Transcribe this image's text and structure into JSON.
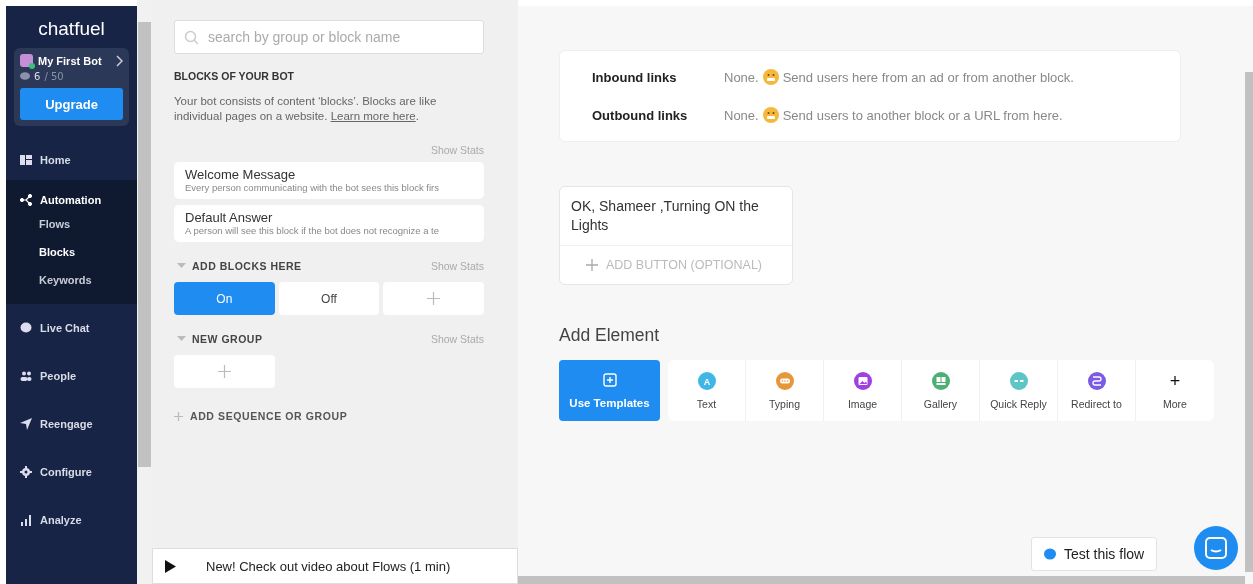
{
  "sidebar": {
    "logo": "chatfuel",
    "bot": {
      "name": "My First Bot",
      "used": "6",
      "limit": "/ 50",
      "upgrade": "Upgrade"
    },
    "items": [
      {
        "label": "Home",
        "kind": "home",
        "selected": false
      },
      {
        "label": "Automation",
        "kind": "automation",
        "selected": true,
        "expanded": true,
        "children": [
          {
            "label": "Flows",
            "selected": false
          },
          {
            "label": "Blocks",
            "selected": true
          },
          {
            "label": "Keywords",
            "selected": false
          }
        ]
      },
      {
        "label": "Live Chat",
        "kind": "chat",
        "selected": false
      },
      {
        "label": "People",
        "kind": "people",
        "selected": false
      },
      {
        "label": "Reengage",
        "kind": "send",
        "selected": false
      },
      {
        "label": "Configure",
        "kind": "gear",
        "selected": false
      },
      {
        "label": "Analyze",
        "kind": "bars",
        "selected": false
      }
    ]
  },
  "blocks_panel": {
    "search": {
      "placeholder": "search by group or block name"
    },
    "heading": "BLOCKS OF YOUR BOT",
    "intro": "Your bot consists of content ‘blocks’. Blocks are like individual pages on a website.",
    "intro_link": "Learn more here",
    "intro_end": ".",
    "show_stats": "Show Stats",
    "blocks": [
      {
        "title": "Welcome Message",
        "subtitle": "Every person communicating with the bot sees this block firs"
      },
      {
        "title": "Default Answer",
        "subtitle": "A person will see this block if the bot does not recognize a te"
      }
    ],
    "groups": [
      {
        "name": "ADD BLOCKS HERE",
        "show_stats": "Show Stats",
        "expanded": true,
        "blocks": [
          {
            "label": "On",
            "selected": true
          },
          {
            "label": "Off",
            "selected": false
          }
        ]
      },
      {
        "name": "NEW GROUP",
        "show_stats": "Show Stats",
        "expanded": true
      }
    ],
    "add_group": "ADD SEQUENCE OR GROUP",
    "video_banner": "New! Check out video about Flows (1 min)"
  },
  "editor": {
    "links": [
      {
        "label": "Inbound links",
        "none": "None.",
        "text": "Send users here from an ad or from another block."
      },
      {
        "label": "Outbound links",
        "none": "None.",
        "text": "Send users to another block or a URL from here."
      }
    ],
    "message": "OK, Shameer ,Turning ON the Lights",
    "add_button": "ADD BUTTON (OPTIONAL)",
    "add_element_title": "Add Element",
    "templates": "Use Templates",
    "elements": [
      {
        "label": "Text",
        "kind": "letter",
        "glyph": "A",
        "color": "#3fb6e6"
      },
      {
        "label": "Typing",
        "kind": "dots",
        "color": "#e8963a"
      },
      {
        "label": "Image",
        "kind": "image",
        "color": "#a23fe0"
      },
      {
        "label": "Gallery",
        "kind": "gallery",
        "color": "#4caf74"
      },
      {
        "label": "Quick Reply",
        "kind": "pill",
        "color": "#5cc6c6"
      },
      {
        "label": "Redirect to",
        "kind": "route",
        "color": "#7b5ae6"
      },
      {
        "label": "More",
        "kind": "plus",
        "glyph": "+"
      }
    ],
    "test_flow": "Test this flow"
  }
}
